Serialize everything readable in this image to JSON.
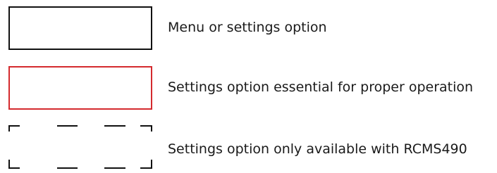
{
  "legend": {
    "items": [
      {
        "style": "solid-black",
        "color": "#111111",
        "label": "Menu or settings option"
      },
      {
        "style": "solid-red",
        "color": "#d42a2e",
        "label": "Settings option essential for proper operation"
      },
      {
        "style": "dashed-black",
        "color": "#111111",
        "label": "Settings option only available with RCMS490"
      }
    ]
  }
}
